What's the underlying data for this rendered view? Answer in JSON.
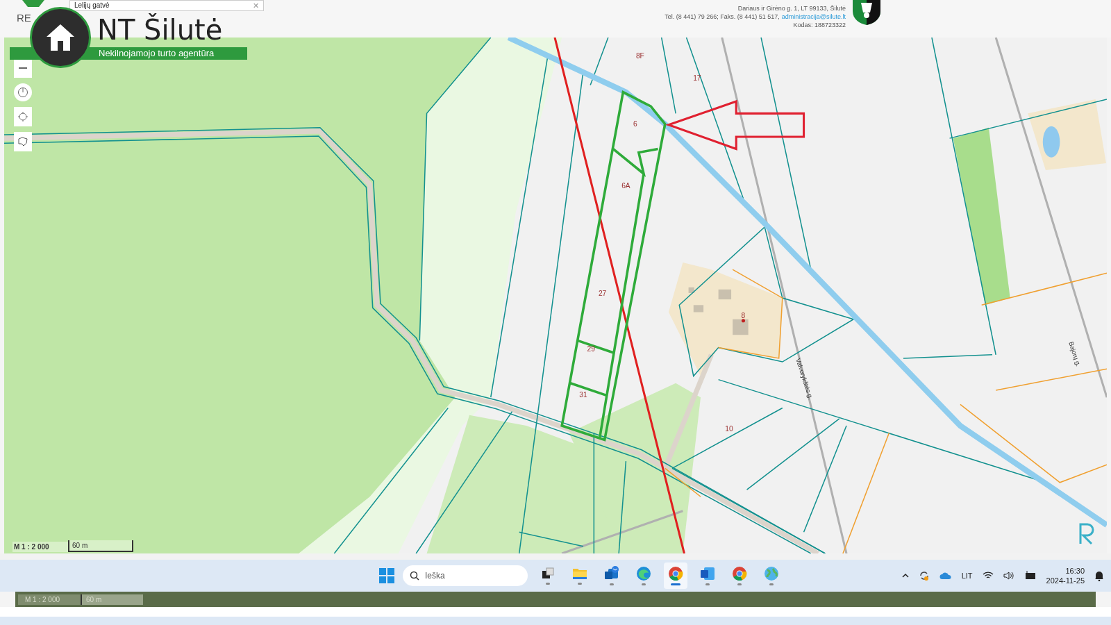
{
  "header": {
    "brand_fragment": "RE",
    "search": {
      "value": "Lelijų gatvė",
      "clear_symbol": "✕"
    },
    "contact": {
      "address": "Dariaus ir Girėno g. 1, LT 99133, Šilutė",
      "phones": "Tel. (8 441) 79 266; Faks. (8 441) 51 517,",
      "email": "administracija@silute.lt",
      "code": "Kodas: 188723322"
    }
  },
  "logo": {
    "title": "NT Šilutė",
    "subtitle": "Nekilnojamojo turto agentūra"
  },
  "map": {
    "parcel_labels": [
      "8F",
      "17",
      "6",
      "6A",
      "27",
      "29",
      "31",
      "8",
      "10"
    ],
    "street_labels": [
      "Valvorykštės g.",
      "Bajorų g."
    ],
    "scale": {
      "ratio": "M 1 : 2 000",
      "distance": "60 m"
    }
  },
  "taskbar": {
    "search": {
      "placeholder": "Ieška"
    },
    "apps": [
      {
        "kind": "task-view",
        "selected": false
      },
      {
        "kind": "folder",
        "selected": false
      },
      {
        "kind": "mail",
        "selected": false
      },
      {
        "kind": "browser-wave",
        "selected": false
      },
      {
        "kind": "browser-ring",
        "selected": true
      },
      {
        "kind": "document",
        "selected": false
      },
      {
        "kind": "browser-ring",
        "selected": false
      },
      {
        "kind": "globe",
        "selected": false
      }
    ],
    "language": "LIT",
    "time": "16:30",
    "date": "2024-11-25"
  },
  "background_window": {
    "scale": {
      "ratio": "M 1 : 2 000",
      "distance": "60 m"
    }
  }
}
